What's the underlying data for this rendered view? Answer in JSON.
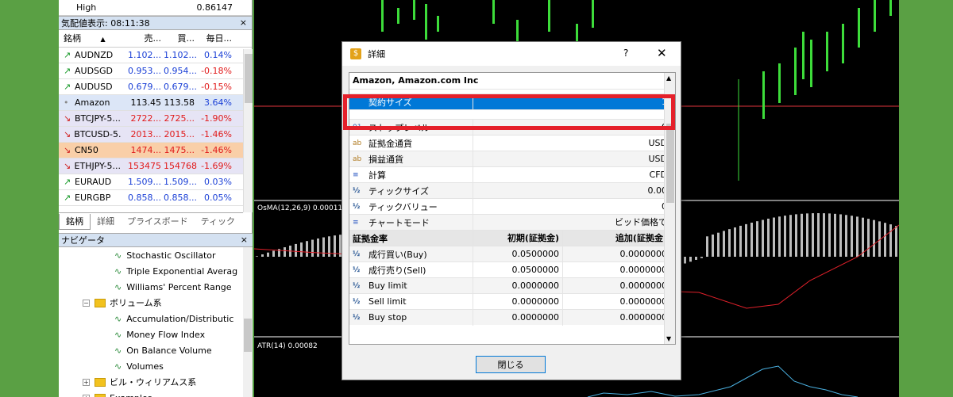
{
  "high_row": {
    "label": "High",
    "value": "0.86147"
  },
  "market_watch": {
    "title": "気配値表示: 08:11:38",
    "close": "×",
    "headers": {
      "symbol": "銘柄",
      "sort": "▲",
      "bid": "売...",
      "ask": "買...",
      "change": "毎日..."
    },
    "rows": [
      {
        "symbol": "AUDNZD",
        "bid": "1.102...",
        "ask": "1.102...",
        "change": "0.14%",
        "dir": "up",
        "bid_color": "#1a3fd6",
        "change_color": "#1a3fd6",
        "bg": "#ffffff"
      },
      {
        "symbol": "AUDSGD",
        "bid": "0.953...",
        "ask": "0.954...",
        "change": "-0.18%",
        "dir": "up",
        "bid_color": "#1a3fd6",
        "change_color": "#e11a1a",
        "bg": "#ffffff"
      },
      {
        "symbol": "AUDUSD",
        "bid": "0.679...",
        "ask": "0.679...",
        "change": "-0.15%",
        "dir": "up",
        "bid_color": "#1a3fd6",
        "change_color": "#e11a1a",
        "bg": "#ffffff"
      },
      {
        "symbol": "Amazon",
        "bid": "113.45",
        "ask": "113.58",
        "change": "3.64%",
        "dir": "dot",
        "bid_color": "#000000",
        "change_color": "#1a3fd6",
        "bg": "#dce6f7"
      },
      {
        "symbol": "BTCJPY-5...",
        "bid": "2722...",
        "ask": "2725...",
        "change": "-1.90%",
        "dir": "down",
        "bid_color": "#e11a1a",
        "change_color": "#e11a1a",
        "bg": "#e6e4f5"
      },
      {
        "symbol": "BTCUSD-5...",
        "bid": "2013...",
        "ask": "2015...",
        "change": "-1.46%",
        "dir": "down",
        "bid_color": "#e11a1a",
        "change_color": "#e11a1a",
        "bg": "#e6e4f5"
      },
      {
        "symbol": "CN50",
        "bid": "1474...",
        "ask": "1475...",
        "change": "-1.46%",
        "dir": "down",
        "bid_color": "#e11a1a",
        "change_color": "#e11a1a",
        "bg": "#f9cfa8"
      },
      {
        "symbol": "ETHJPY-5...",
        "bid": "153475",
        "ask": "154768",
        "change": "-1.69%",
        "dir": "down",
        "bid_color": "#e11a1a",
        "change_color": "#e11a1a",
        "bg": "#e6e4f5"
      },
      {
        "symbol": "EURAUD",
        "bid": "1.509...",
        "ask": "1.509...",
        "change": "0.03%",
        "dir": "up",
        "bid_color": "#1a3fd6",
        "change_color": "#1a3fd6",
        "bg": "#ffffff"
      },
      {
        "symbol": "EURGBP",
        "bid": "0.858...",
        "ask": "0.858...",
        "change": "0.05%",
        "dir": "up",
        "bid_color": "#1a3fd6",
        "change_color": "#1a3fd6",
        "bg": "#ffffff"
      }
    ],
    "tabs": [
      "銘柄",
      "詳細",
      "プライスボード",
      "ティック"
    ]
  },
  "navigator": {
    "title": "ナビゲータ",
    "close": "×",
    "items": [
      {
        "label": "Stochastic Oscillator",
        "type": "indicator"
      },
      {
        "label": "Triple Exponential Averag",
        "type": "indicator"
      },
      {
        "label": "Williams' Percent Range",
        "type": "indicator"
      },
      {
        "label": "ボリューム系",
        "type": "folder"
      },
      {
        "label": "Accumulation/Distributic",
        "type": "indicator"
      },
      {
        "label": "Money Flow Index",
        "type": "indicator"
      },
      {
        "label": "On Balance Volume",
        "type": "indicator"
      },
      {
        "label": "Volumes",
        "type": "indicator"
      },
      {
        "label": "ビル・ウィリアムス系",
        "type": "folder-plus"
      },
      {
        "label": "Examples",
        "type": "folder-plus"
      }
    ]
  },
  "chart": {
    "osma_label": "OsMA(12,26,9) 0.000115",
    "atr_label": "ATR(14) 0.00082"
  },
  "dialog": {
    "title": "詳細",
    "help": "?",
    "close_x": "✕",
    "group_title": "Amazon, Amazon.com Inc",
    "rows": [
      {
        "icon": "",
        "label": "契約サイズ",
        "value": "1",
        "selected": true
      },
      {
        "icon": "01",
        "label": "ストップレベル",
        "value": "0"
      },
      {
        "icon": "ab",
        "label": "証拠金通貨",
        "value": "USD"
      },
      {
        "icon": "ab",
        "label": "損益通貨",
        "value": "USD"
      },
      {
        "icon": "≡",
        "label": "計算",
        "value": "CFD"
      },
      {
        "icon": "½",
        "label": "ティックサイズ",
        "value": "0.00"
      },
      {
        "icon": "½",
        "label": "ティックバリュー",
        "value": "0"
      },
      {
        "icon": "≡",
        "label": "チャートモード",
        "value": "ビッド価格で"
      }
    ],
    "margin_header": {
      "label": "証拠金率",
      "initial": "初期(証拠金)",
      "additional": "追加(証拠金)"
    },
    "margin_rows": [
      {
        "label": "成行買い(Buy)",
        "initial": "0.0500000",
        "additional": "0.0000000"
      },
      {
        "label": "成行売り(Sell)",
        "initial": "0.0500000",
        "additional": "0.0000000"
      },
      {
        "label": "Buy limit",
        "initial": "0.0000000",
        "additional": "0.0000000"
      },
      {
        "label": "Sell limit",
        "initial": "0.0000000",
        "additional": "0.0000000"
      },
      {
        "label": "Buy stop",
        "initial": "0.0000000",
        "additional": "0.0000000"
      }
    ],
    "close_button": "閉じる"
  }
}
